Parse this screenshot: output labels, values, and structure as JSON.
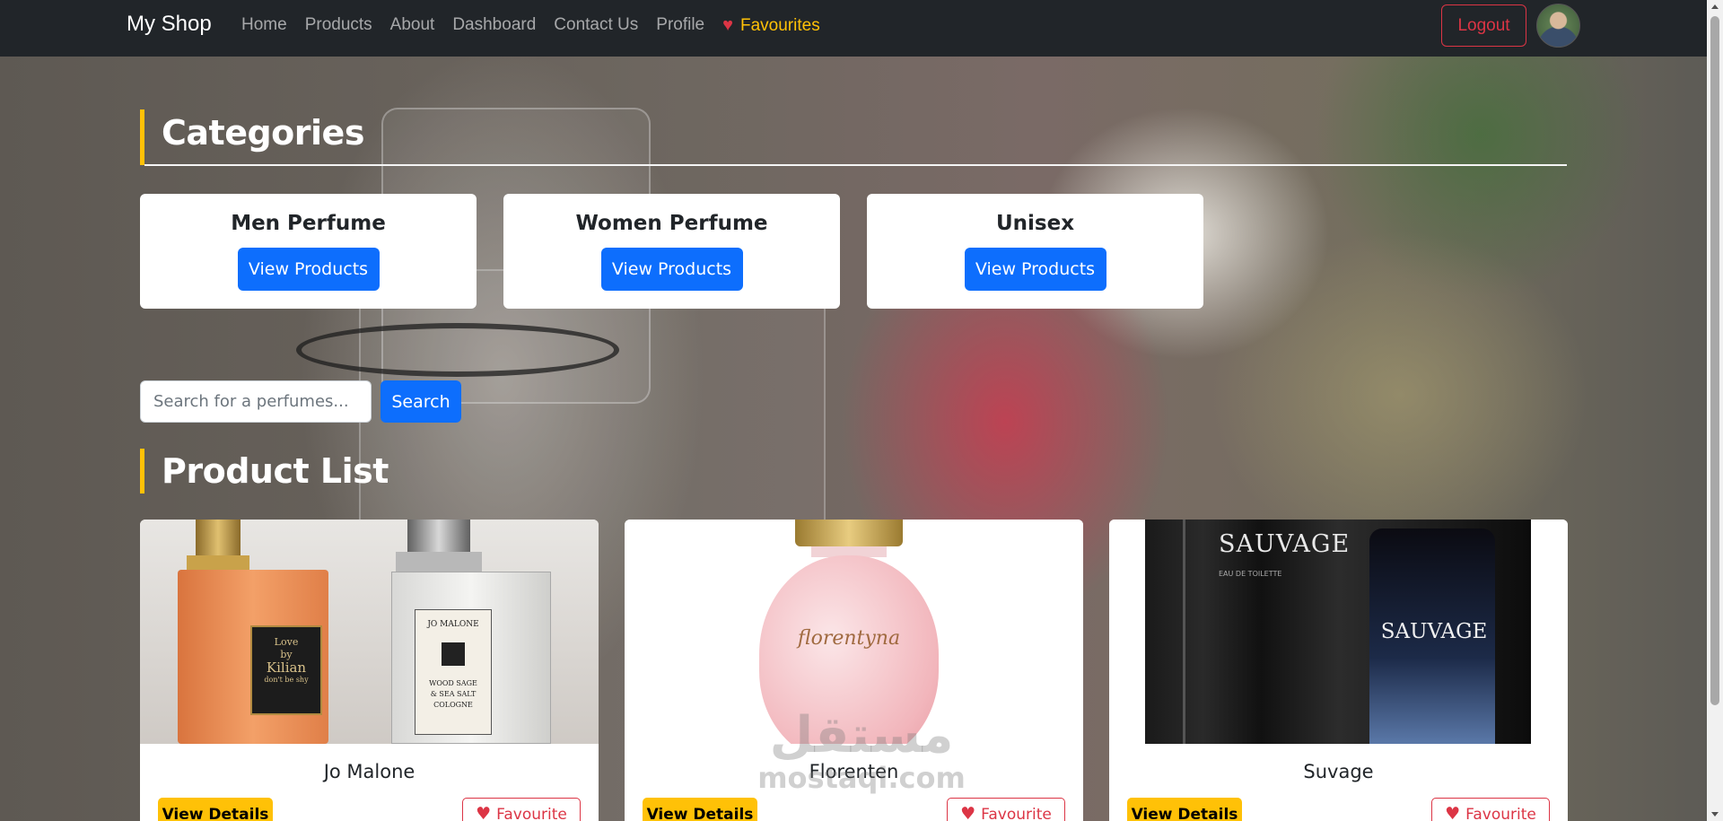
{
  "navbar": {
    "brand": "My Shop",
    "links": [
      "Home",
      "Products",
      "About",
      "Dashboard",
      "Contact Us",
      "Profile"
    ],
    "favourites_label": "Favourites",
    "logout_label": "Logout"
  },
  "categories": {
    "heading": "Categories",
    "items": [
      {
        "title": "Men Perfume",
        "button": "View Products"
      },
      {
        "title": "Women Perfume",
        "button": "View Products"
      },
      {
        "title": "Unisex",
        "button": "View Products"
      }
    ]
  },
  "search": {
    "placeholder": "Search for a perfumes...",
    "button": "Search"
  },
  "products": {
    "heading": "Product List",
    "items": [
      {
        "name": "Jo Malone",
        "details_button": "View Details",
        "fav_button": "Favourite",
        "image_text": [
          "Love",
          "by",
          "Kilian",
          "don't be shy",
          "JO MALONE",
          "WOOD SAGE",
          "& SEA SALT",
          "COLOGNE"
        ]
      },
      {
        "name": "Florenten",
        "details_button": "View Details",
        "fav_button": "Favourite",
        "image_text": [
          "florentyna"
        ]
      },
      {
        "name": "Suvage",
        "details_button": "View Details",
        "fav_button": "Favourite",
        "image_text": [
          "SAUVAGE",
          "EAU DE TOILETTE",
          "SAUVAGE"
        ]
      }
    ]
  },
  "watermark": {
    "line1": "مستقل",
    "line2": "mostaqi.com"
  },
  "colors": {
    "navbar_bg": "#212529",
    "accent_yellow": "#ffc107",
    "primary_blue": "#0d6efd",
    "danger_red": "#dc3545"
  }
}
